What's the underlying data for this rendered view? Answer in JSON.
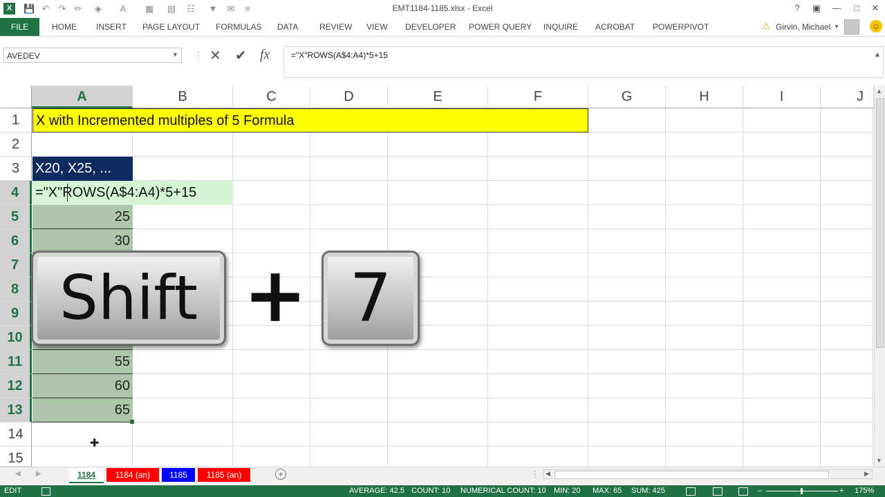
{
  "window": {
    "title": "EMT1184-1185.xlsx - Excel",
    "help": "?",
    "minimize": "—",
    "restore": "□",
    "close": "✕"
  },
  "ribbon": {
    "file": "FILE",
    "tabs": [
      "HOME",
      "INSERT",
      "PAGE LAYOUT",
      "FORMULAS",
      "DATA",
      "REVIEW",
      "VIEW",
      "DEVELOPER",
      "POWER QUERY",
      "INQUIRE",
      "ACROBAT",
      "POWERPIVOT"
    ],
    "user": "Girvin, Michael"
  },
  "formula_bar": {
    "name_box": "AVEDEV",
    "formula": "=\"X\"ROWS(A$4:A4)*5+15",
    "cancel": "✕",
    "enter": "✔",
    "fx": "fx"
  },
  "grid": {
    "columns": [
      "A",
      "B",
      "C",
      "D",
      "E",
      "F",
      "G",
      "H",
      "I",
      "J"
    ],
    "rows": [
      "1",
      "2",
      "3",
      "4",
      "5",
      "6",
      "7",
      "8",
      "9",
      "10",
      "11",
      "12",
      "13",
      "14",
      "15"
    ],
    "cells": {
      "A1": "X with Incremented multiples of 5 Formula",
      "A3": "X20, X25, ...",
      "A4": "=\"X\"ROWS(A$4:A4)*5+15",
      "A5": "25",
      "A6": "30",
      "A11": "55",
      "A12": "60",
      "A13": "65"
    }
  },
  "overlay": {
    "key1": "Shift",
    "plus": "+",
    "key2": "7"
  },
  "sheets": [
    "1184",
    "1184 (an)",
    "1185",
    "1185 (an)"
  ],
  "status": {
    "mode": "EDIT",
    "average": "AVERAGE: 42.5",
    "count": "COUNT: 10",
    "numerical_count": "NUMERICAL COUNT: 10",
    "min": "MIN: 20",
    "max": "MAX: 65",
    "sum": "SUM: 425",
    "zoom": "175%"
  },
  "colors": {
    "excel_green": "#217346",
    "title_fill": "#ffff00",
    "header_fill": "#0e2a5e",
    "selection_fill": "#adc5a9",
    "sheet_tab_red": "#ff0000",
    "sheet_tab_blue": "#0000ff"
  }
}
